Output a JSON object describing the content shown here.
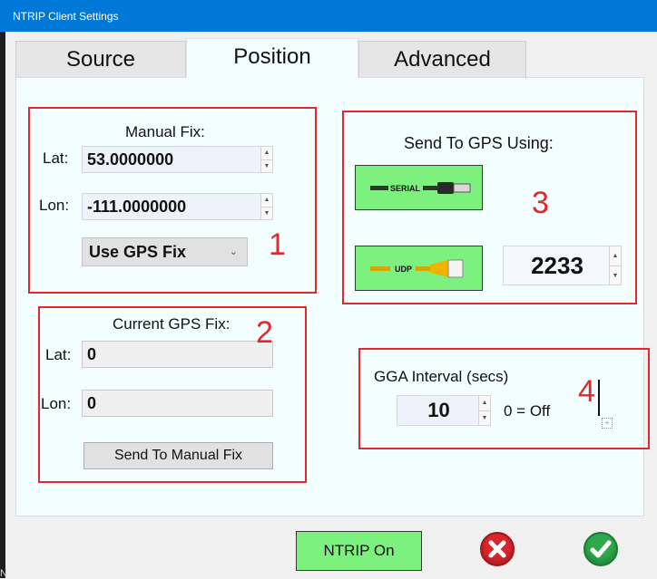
{
  "window": {
    "title": "NTRIP Client Settings",
    "edge_text": "N"
  },
  "tabs": [
    {
      "label": "Source",
      "active": false
    },
    {
      "label": "Position",
      "active": true
    },
    {
      "label": "Advanced",
      "active": false
    }
  ],
  "manual_fix": {
    "number": "1",
    "heading": "Manual Fix:",
    "lat_label": "Lat:",
    "lat_value": "53.0000000",
    "lon_label": "Lon:",
    "lon_value": "-111.0000000",
    "mode_selected": "Use GPS Fix"
  },
  "current_gps_fix": {
    "number": "2",
    "heading": "Current GPS Fix:",
    "lat_label": "Lat:",
    "lat_value": "0",
    "lon_label": "Lon:",
    "lon_value": "0",
    "send_button": "Send To Manual Fix"
  },
  "send_to_gps": {
    "number": "3",
    "heading": "Send To GPS Using:",
    "serial_label": "SERIAL",
    "udp_label": "UDP",
    "udp_port": "2233"
  },
  "gga": {
    "number": "4",
    "heading": "GGA Interval (secs)",
    "value": "10",
    "off_hint": "0 = Off"
  },
  "footer": {
    "ntrip_button": "NTRIP On"
  },
  "colors": {
    "accent_red": "#e0282e",
    "button_green": "#7cf17d",
    "title_blue": "#0078d7",
    "panel_bg": "#f2fffe"
  },
  "icons": {
    "cancel": "cancel-x-icon",
    "ok": "ok-check-icon",
    "serial": "usb-cable-icon",
    "udp": "ethernet-cable-icon"
  }
}
